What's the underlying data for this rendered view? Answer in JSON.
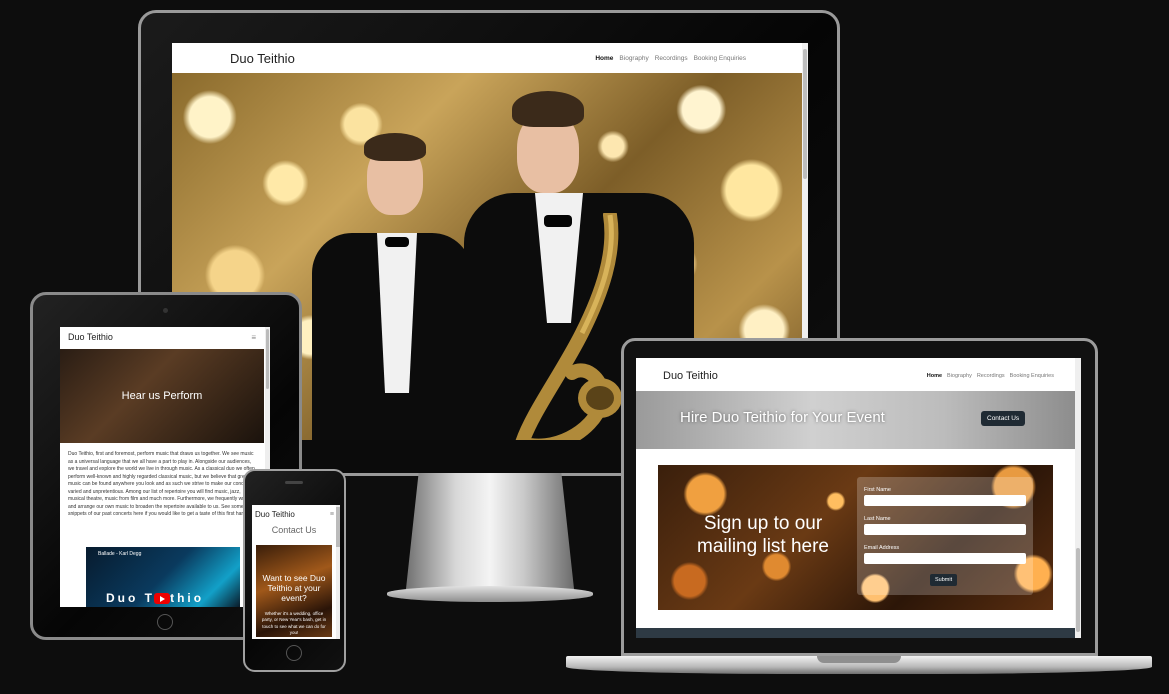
{
  "brand": "Duo Teithio",
  "nav": {
    "home": "Home",
    "biography": "Biography",
    "recordings": "Recordings",
    "booking": "Booking Enquiries"
  },
  "menu_icon": "≡",
  "icons": {
    "menu": "hamburger-menu-icon",
    "play": "youtube-play-icon"
  },
  "laptop": {
    "banner_title": "Hire Duo Teithio for Your Event",
    "contact_button": "Contact Us",
    "signup_heading": "Sign up to our mailing list here",
    "form": {
      "first_name_label": "First Name",
      "last_name_label": "Last Name",
      "email_label": "Email Address",
      "submit_label": "Submit"
    }
  },
  "tablet": {
    "hero_title": "Hear us Perform",
    "intro_text": "Duo Teithio, first and foremost, perform music that draws us together. We see music as a universal language that we all have a part to play in. Alongside our audiences, we travel and explore the world we live in through music. As a classical duo we often perform well-known and highly regarded classical music, but we believe that great music can be found anywhere you look and as such we strive to make our concerts varied and unpretentious. Among our list of repertoire you will find music, jazz, musical theatre, music from film and much more. Furthermore, we frequently write and arrange our own music to broaden the repertoire available to us. See some snippets of our past concerts here if you would like to get a taste of this first hand.",
    "video_title": "Ballade - Karl Degg",
    "video_overlay": "Duo Teithio"
  },
  "phone": {
    "contact_heading": "Contact Us",
    "card_title": "Want to see Duo Teithio at your event?",
    "card_text": "Whether it's a wedding, office party, or New Year's bash, get in touch to see what we can do for you!"
  }
}
